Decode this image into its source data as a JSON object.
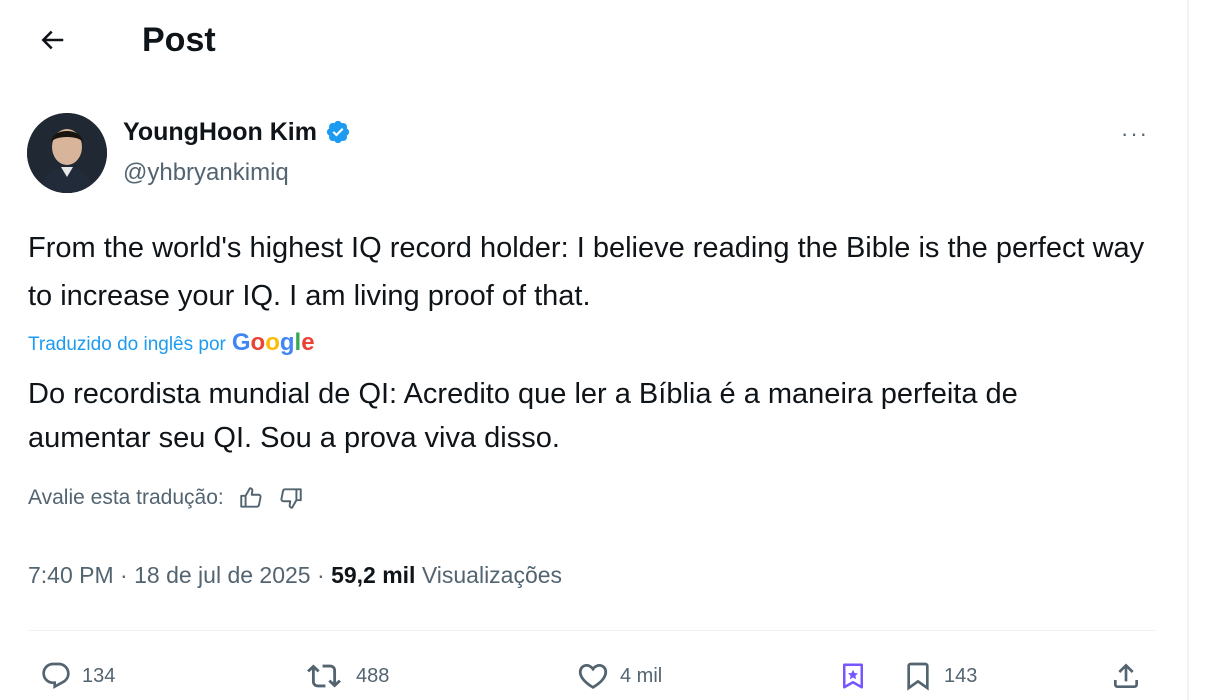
{
  "header": {
    "back_icon": "arrow-left-icon",
    "title": "Post"
  },
  "author": {
    "name": "YoungHoon Kim",
    "handle": "@yhbryankimiq",
    "verified_icon": "verified-badge-icon",
    "more_icon": "more-icon",
    "more_label": "···"
  },
  "post": {
    "text": "From the world's highest IQ record holder: I believe reading the Bible is the perfect way to increase your IQ. I am living proof of that.",
    "translation_label": "Traduzido do inglês por",
    "translation_provider": "Google",
    "translated_text": "Do recordista mundial de QI: Acredito que ler a Bíblia é a maneira perfeita de aumentar seu QI. Sou a prova viva disso.",
    "rate_label": "Avalie esta tradução:"
  },
  "meta": {
    "time": "7:40 PM",
    "separator": "·",
    "date": "18 de jul de 2025",
    "views_count": "59,2 mil",
    "views_label": "Visualizações"
  },
  "actions": {
    "replies": "134",
    "reposts": "488",
    "likes": "4 mil",
    "bookmarks": "143"
  },
  "colors": {
    "accent": "#1d9bf0",
    "secondary_text": "#536471",
    "primary_text": "#0f1419",
    "grok_purple": "#7856ff"
  }
}
